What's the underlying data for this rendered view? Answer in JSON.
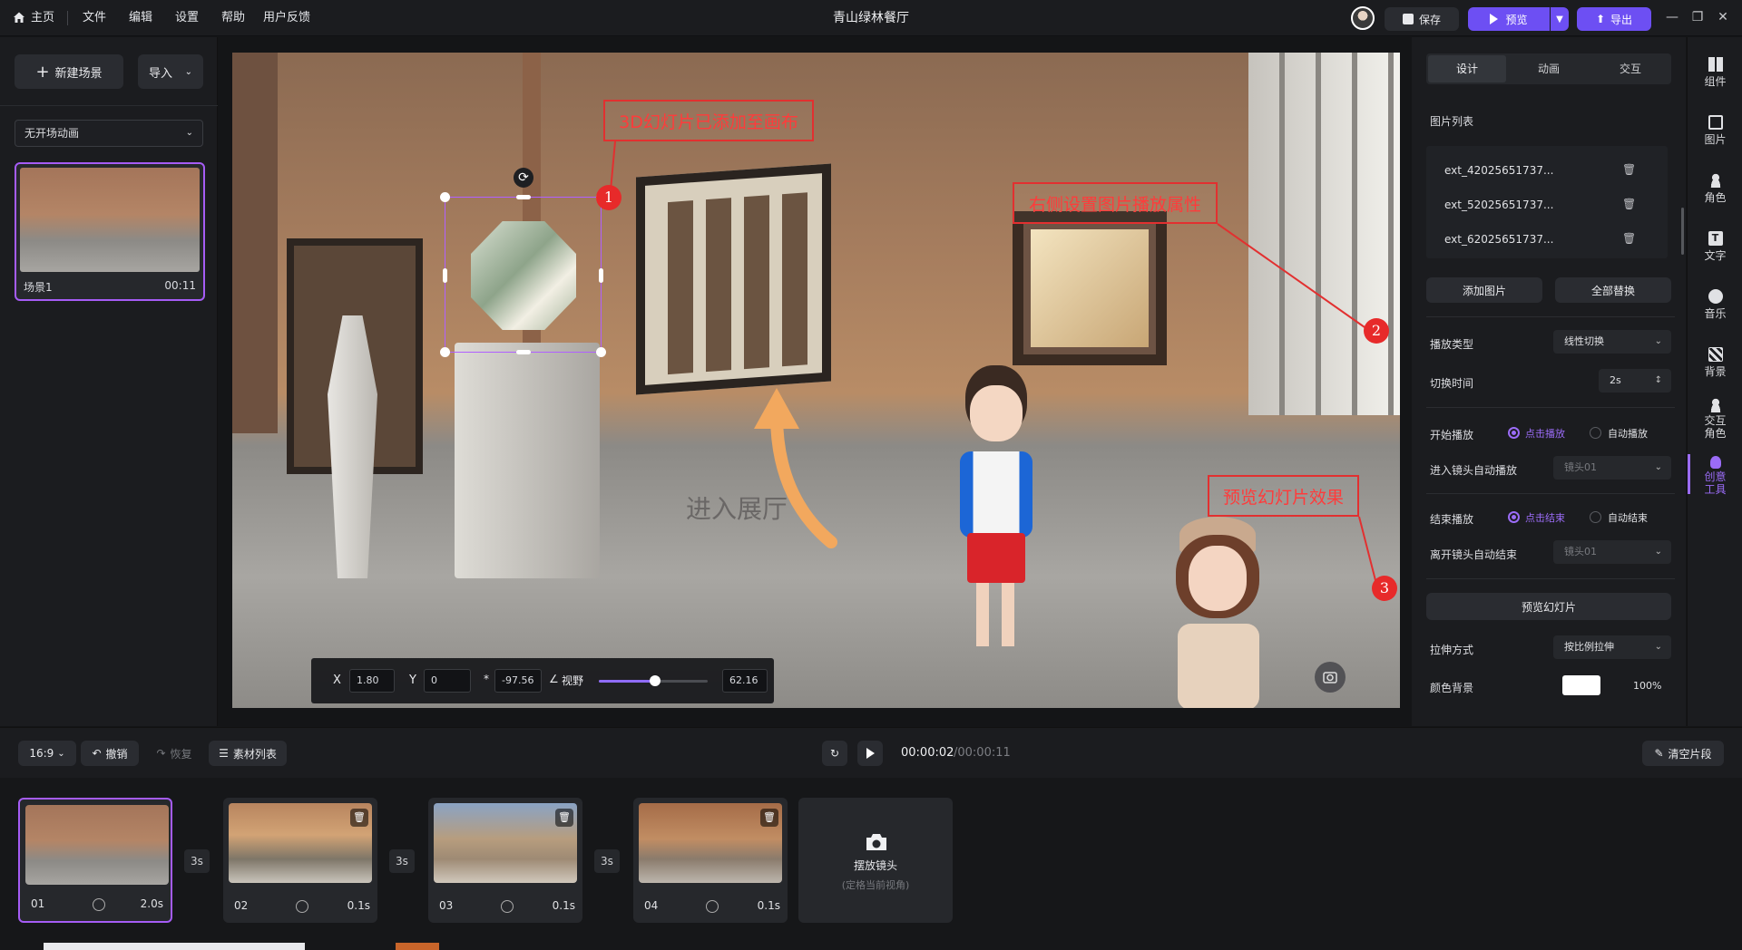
{
  "app": {
    "title": "青山绿林餐厅",
    "menu": [
      "主页",
      "文件",
      "编辑",
      "设置",
      "帮助",
      "用户反馈"
    ],
    "save_label": "保存",
    "preview_label": "预览",
    "export_label": "导出"
  },
  "left": {
    "new_scene_label": "新建场景",
    "import_label": "导入",
    "scene_anim_select": "无开场动画",
    "scene": {
      "name": "场景1",
      "duration": "00:11"
    }
  },
  "canvas": {
    "annotations": [
      {
        "text": "3D幻灯片已添加至画布",
        "num": "1"
      },
      {
        "text": "右侧设置图片播放属性",
        "num": "2"
      },
      {
        "text": "预览幻灯片效果",
        "num": "3"
      }
    ],
    "floor_text": "进入展厅",
    "coords": {
      "x_label": "X",
      "x_value": "1.80",
      "y_label": "Y",
      "y_value": "0",
      "z_label": "*",
      "z_value": "-97.56",
      "fov_label": "视野",
      "fov_value": "62.16",
      "fov_level": 0.52
    }
  },
  "right": {
    "tabs": [
      "设计",
      "动画",
      "交互"
    ],
    "image_list_title": "图片列表",
    "images": [
      "ext_42025651737...",
      "ext_52025651737...",
      "ext_62025651737..."
    ],
    "add_image_label": "添加图片",
    "replace_all_label": "全部替换",
    "play_type_label": "播放类型",
    "play_type_value": "线性切换",
    "switch_time_label": "切换时间",
    "switch_time_value": "2s",
    "start_play_label": "开始播放",
    "start_opt1": "点击播放",
    "start_opt2": "自动播放",
    "enter_auto_label": "进入镜头自动播放",
    "enter_auto_value": "镜头01",
    "end_play_label": "结束播放",
    "end_opt1": "点击结束",
    "end_opt2": "自动结束",
    "leave_auto_label": "离开镜头自动结束",
    "leave_auto_value": "镜头01",
    "preview_slide_label": "预览幻灯片",
    "stretch_label": "拉伸方式",
    "stretch_value": "按比例拉伸",
    "bg_color_label": "颜色背景",
    "bg_color_value": "#ffffff",
    "bg_opacity": "100%"
  },
  "toolbar": [
    "组件",
    "图片",
    "角色",
    "文字",
    "音乐",
    "背景",
    "交互角色",
    "创意工具"
  ],
  "bottom": {
    "ratio": "16:9",
    "undo_label": "撤销",
    "redo_label": "恢复",
    "assets_label": "素材列表",
    "time_current": "00:00:02",
    "time_total": "/00:00:11",
    "clear_label": "清空片段"
  },
  "shots": [
    {
      "num": "01",
      "dur": "2.0s"
    },
    {
      "num": "02",
      "dur": "0.1s"
    },
    {
      "num": "03",
      "dur": "0.1s"
    },
    {
      "num": "04",
      "dur": "0.1s"
    }
  ],
  "gaps": [
    "3s",
    "3s",
    "3s"
  ],
  "place_camera": {
    "title": "摆放镜头",
    "sub": "(定格当前视角)"
  },
  "colors": {
    "accent": "#6d4ff3",
    "annotation": "#e23030",
    "selection": "#b060ff"
  }
}
